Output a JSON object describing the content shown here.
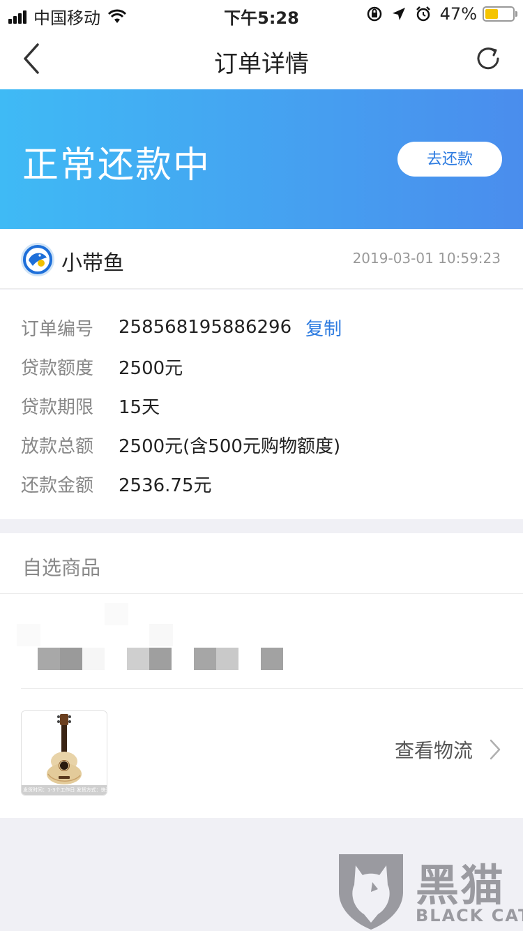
{
  "status_bar": {
    "carrier": "中国移动",
    "time": "下午5:28",
    "battery_percent": "47%",
    "battery_level": 0.47,
    "icons": [
      "signal-icon",
      "wifi-icon",
      "rotation-lock-icon",
      "location-icon",
      "alarm-icon",
      "battery-icon"
    ]
  },
  "nav": {
    "title": "订单详情",
    "back_icon": "back-chevron-icon",
    "refresh_icon": "refresh-icon"
  },
  "banner": {
    "status_title": "正常还款中",
    "repay_button": "去还款",
    "gradient_start": "#3fbaf5",
    "gradient_end": "#4a8ded"
  },
  "merchant": {
    "name": "小带鱼",
    "datetime": "2019-03-01 10:59:23",
    "logo_icon": "fish-logo-icon"
  },
  "details": {
    "rows": [
      {
        "label": "订单编号",
        "value": "258568195886296",
        "action": "复制"
      },
      {
        "label": "贷款额度",
        "value": "2500元"
      },
      {
        "label": "贷款期限",
        "value": "15天"
      },
      {
        "label": "放款总额",
        "value": "2500元(含500元购物额度)"
      },
      {
        "label": "还款金额",
        "value": "2536.75元"
      }
    ]
  },
  "products": {
    "section_title": "自选商品",
    "thumbnail_caption": "发货时间：1-3个工作日  发货方式：快递",
    "logistics_label": "查看物流",
    "product_icon": "ukulele-image"
  },
  "watermark": {
    "cn": "黑猫",
    "en": "BLACK CAT"
  },
  "colors": {
    "link": "#2d7be0",
    "label_gray": "#888888",
    "background": "#f0f0f5"
  }
}
